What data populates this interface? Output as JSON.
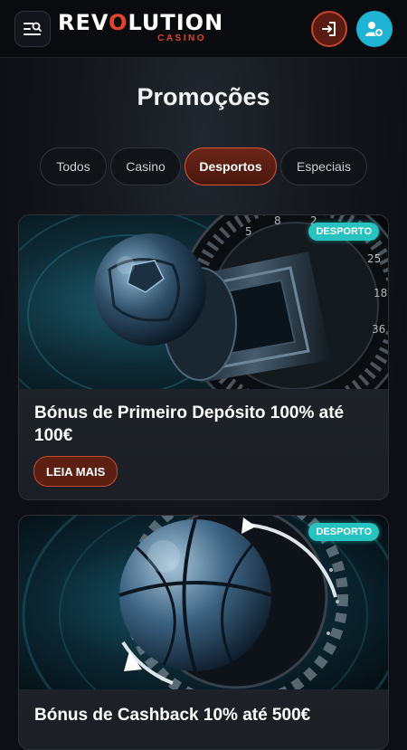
{
  "header": {
    "logo_main_prefix": "REV",
    "logo_main_o": "O",
    "logo_main_suffix": "LUTION",
    "logo_sub": "CASINO",
    "icons": {
      "menu": "menu-search-icon",
      "login": "login-icon",
      "register": "add-user-icon"
    },
    "colors": {
      "brand_red": "#e3432a",
      "register_blue": "#1fb4d6"
    }
  },
  "page": {
    "title": "Promoções"
  },
  "tabs": [
    {
      "label": "Todos",
      "active": false
    },
    {
      "label": "Casino",
      "active": false
    },
    {
      "label": "Desportos",
      "active": true
    },
    {
      "label": "Especiais",
      "active": false
    }
  ],
  "promotions": [
    {
      "badge": "DESPORTO",
      "title": "Bónus de Primeiro Depósito 100% até 100€",
      "cta": "LEIA MAIS",
      "image": "roulette-soccer-ball"
    },
    {
      "badge": "DESPORTO",
      "title": "Bónus de Cashback 10% até 500€",
      "image": "basketball-arrows"
    }
  ],
  "colors": {
    "accent_red": "#c8492d",
    "badge_teal": "#27c3c0"
  }
}
